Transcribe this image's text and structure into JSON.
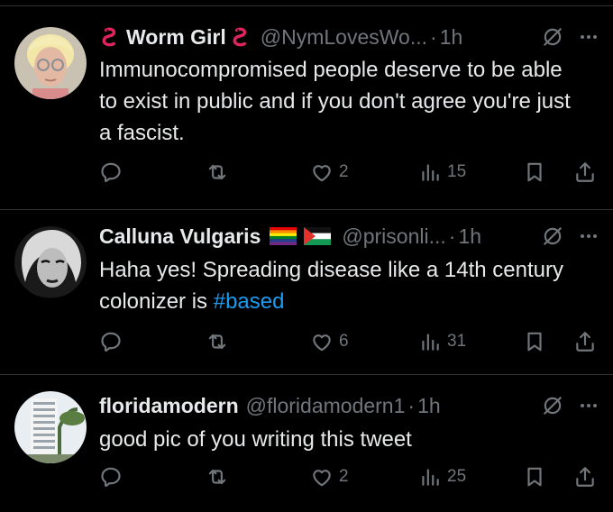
{
  "tweets": [
    {
      "display_name": "Worm Girl",
      "handle": "@NymLovesWo...",
      "time": "1h",
      "text": "Immunocompromised people deserve to be able to exist in public and if you don't agree you're just a fascist.",
      "likes": "2",
      "views": "15"
    },
    {
      "display_name": "Calluna Vulgaris",
      "handle": "@prisonli...",
      "time": "1h",
      "text_plain": "Haha yes! Spreading disease like a 14th century colonizer is ",
      "hashtag": "#based",
      "likes": "6",
      "views": "31"
    },
    {
      "display_name": "floridamodern",
      "handle": "@floridamodern1",
      "time": "1h",
      "text": "good pic of you writing this tweet",
      "likes": "2",
      "views": "25"
    }
  ],
  "icons": {
    "reply": "speech-bubble-icon",
    "retweet": "repost-arrows-icon",
    "like": "heart-icon",
    "views": "bar-chart-icon",
    "bookmark": "bookmark-icon",
    "share": "share-upload-icon",
    "grok": "slashed-circle-icon",
    "more": "more-dots-icon",
    "worm": "worm-emoji-icon",
    "rainbow_flag": "rainbow-flag-icon",
    "palestine_flag": "palestine-flag-icon"
  },
  "colors": {
    "background": "#000000",
    "text": "#e7e9ea",
    "muted": "#71767b",
    "link": "#1d9bf0",
    "divider": "#2f3336",
    "worm": "#e0245e"
  }
}
